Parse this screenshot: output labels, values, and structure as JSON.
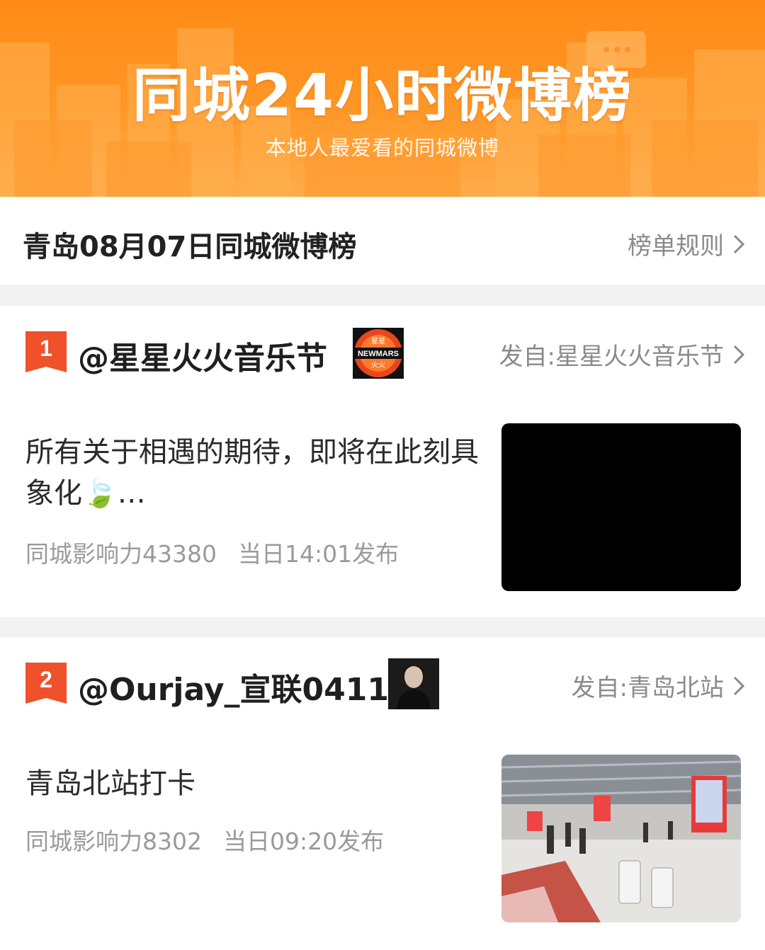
{
  "banner": {
    "title": "同城24小时微博榜",
    "subtitle": "本地人最爱看的同城微博"
  },
  "header": {
    "title": "青岛08月07日同城微博榜",
    "rules_label": "榜单规则"
  },
  "posts": [
    {
      "rank": "1",
      "user": "@星星火火音乐节",
      "avatar_text_top": "星星",
      "avatar_text_mid": "NEWMARS",
      "avatar_text_bot": "火火",
      "source": "发自:星星火火音乐节",
      "text": "所有关于相遇的期待，即将在此刻具象化🍃…",
      "influence": "同城影响力43380",
      "time": "当日14:01发布"
    },
    {
      "rank": "2",
      "user": "@Ourjay_宣联0411",
      "source": "发自:青岛北站",
      "text": "青岛北站打卡",
      "influence": "同城影响力8302",
      "time": "当日09:20发布"
    }
  ],
  "colors": {
    "brand_orange": "#ff8a16",
    "rank_red": "#f0502a",
    "text_gray": "#9a9a9a"
  },
  "icons": [
    "chevron-right-icon",
    "chat-bubble-icon",
    "rank-badge-icon"
  ]
}
